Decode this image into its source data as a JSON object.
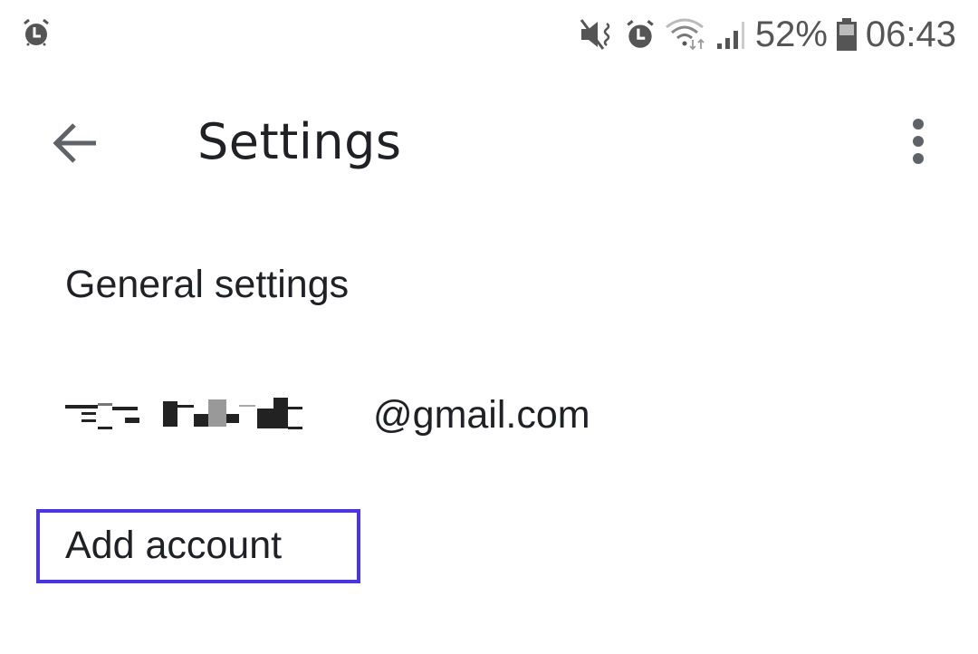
{
  "status_bar": {
    "left_icons": [
      "alarm-icon"
    ],
    "right_icons": [
      "mute-vibrate-icon",
      "alarm-icon",
      "wifi-icon",
      "signal-icon"
    ],
    "battery_percent": "52%",
    "battery_level": 0.52,
    "time": "06:43"
  },
  "app_bar": {
    "back_icon": "arrow-left-icon",
    "title": "Settings",
    "more_icon": "more-vert-icon"
  },
  "settings_list": {
    "items": [
      {
        "label": "General settings"
      },
      {
        "label_suffix": "@gmail.com",
        "redacted_prefix": true
      },
      {
        "label": "Add account",
        "highlighted": true
      }
    ]
  },
  "colors": {
    "highlight": "#4a36e0",
    "text_primary": "#202124",
    "icon_grey": "#5f6368"
  }
}
